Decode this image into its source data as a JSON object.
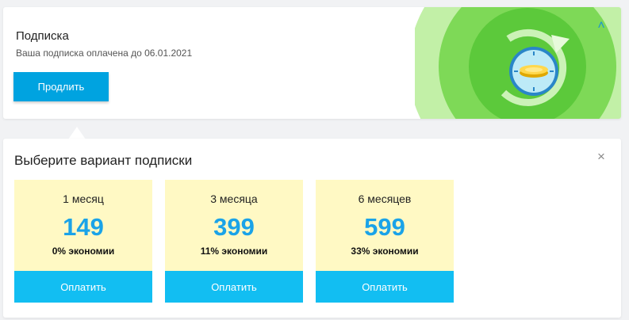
{
  "subscription": {
    "title": "Подписка",
    "status": "Ваша подписка оплачена до 06.01.2021",
    "renew_label": "Продлить",
    "collapse_glyph": "˄",
    "hero_icon": "clock-with-coin-icon"
  },
  "plans_panel": {
    "title": "Выберите вариант подписки",
    "close_glyph": "×",
    "plans": [
      {
        "duration": "1 месяц",
        "price": "149",
        "savings": "0% экономии",
        "pay_label": "Оплатить"
      },
      {
        "duration": "3 месяца",
        "price": "399",
        "savings": "11% экономии",
        "pay_label": "Оплатить"
      },
      {
        "duration": "6 месяцев",
        "price": "599",
        "savings": "33% экономии",
        "pay_label": "Оплатить"
      }
    ]
  },
  "colors": {
    "accent_button": "#00a3e0",
    "pay_button": "#12bef2",
    "price_text": "#1aa3e8",
    "plan_card_bg": "#fff9c4",
    "hero_green": "#7ed957"
  }
}
